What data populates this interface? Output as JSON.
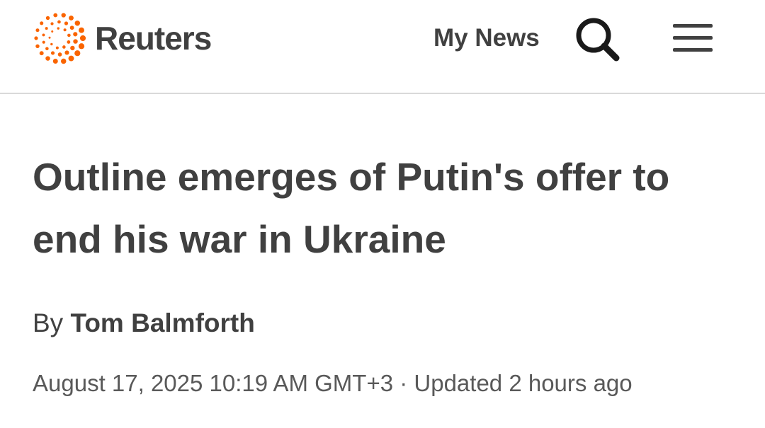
{
  "header": {
    "logo_text": "Reuters",
    "logo_icon": "reuters-dot-circle-logo",
    "logo_color": "#fa6400",
    "my_news_label": "My News",
    "search_icon": "search-icon",
    "menu_icon": "hamburger-menu-icon"
  },
  "article": {
    "headline": "Outline emerges of Putin's offer to end his war in Ukraine",
    "byline_prefix": "By",
    "author": "Tom Balmforth",
    "dateline": "August 17, 2025 10:19 AM GMT+3 · Updated 2 hours ago"
  },
  "colors": {
    "text": "#404040",
    "meta_text": "#595959",
    "divider": "#d9d9d9"
  }
}
